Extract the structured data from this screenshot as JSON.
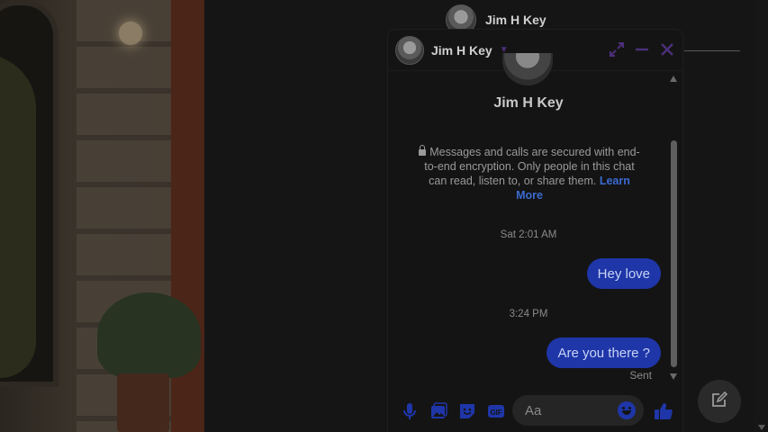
{
  "page_header": {
    "name": "Jim H Key"
  },
  "chat": {
    "title": "Jim H Key",
    "contact_name": "Jim H Key",
    "encryption_notice": "Messages and calls are secured with end-to-end encryption. Only people in this chat can read, listen to, or share them.",
    "learn_more": "Learn More",
    "messages": [
      {
        "timestamp": "Sat 2:01 AM",
        "text": "Hey love"
      },
      {
        "timestamp": "3:24 PM",
        "text": "Are you there ?"
      }
    ],
    "status": "Sent",
    "composer": {
      "placeholder": "Aa"
    }
  },
  "icons": {
    "header": [
      "chevron-down-icon",
      "expand-icon",
      "minimize-icon",
      "close-icon"
    ],
    "composer": [
      "microphone-icon",
      "photo-icon",
      "sticker-icon",
      "gif-icon",
      "emoji-icon",
      "thumbs-up-icon"
    ],
    "fab": "compose-icon"
  },
  "colors": {
    "accent": "#1e36a8",
    "header_icons": "#4c2f7a",
    "link": "#3b6ad0",
    "background": "#151515"
  }
}
